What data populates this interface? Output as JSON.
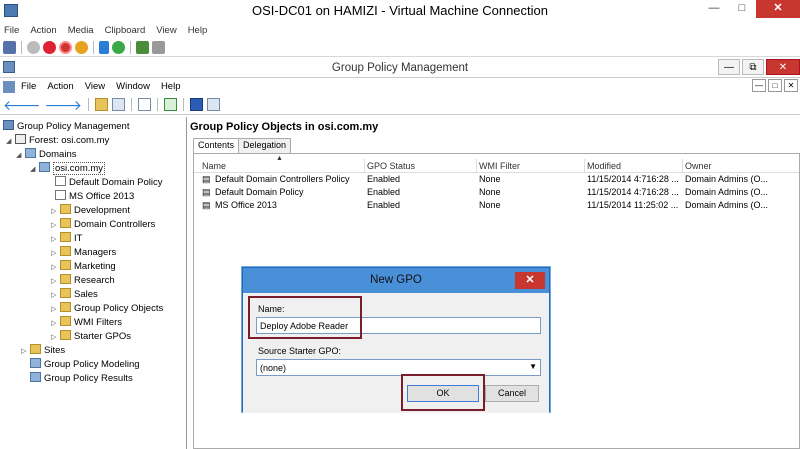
{
  "vm_window": {
    "title": "OSI-DC01 on HAMIZI - Virtual Machine Connection",
    "menu": [
      "File",
      "Action",
      "Media",
      "Clipboard",
      "View",
      "Help"
    ],
    "buttons": {
      "minimize": "—",
      "maximize": "□",
      "close": "✕"
    }
  },
  "gpm_window": {
    "title": "Group Policy Management",
    "menu": [
      "File",
      "Action",
      "View",
      "Window",
      "Help"
    ],
    "buttons": {
      "minimize": "—",
      "maximize": "⧉",
      "close": "✕",
      "mdi_min": "—",
      "mdi_max": "□",
      "mdi_close": "✕"
    }
  },
  "tree": {
    "root": "Group Policy Management",
    "forest": "Forest: osi.com.my",
    "domains": "Domains",
    "domain": "osi.com.my",
    "children": [
      "Default Domain Policy",
      "MS Office 2013",
      "Development",
      "Domain Controllers",
      "IT",
      "Managers",
      "Marketing",
      "Research",
      "Sales",
      "Group Policy Objects",
      "WMI Filters",
      "Starter GPOs"
    ],
    "sites": "Sites",
    "modeling": "Group Policy Modeling",
    "results": "Group Policy Results"
  },
  "right_pane": {
    "title": "Group Policy Objects in osi.com.my",
    "tabs": [
      "Contents",
      "Delegation"
    ],
    "columns": [
      "Name",
      "GPO Status",
      "WMI Filter",
      "Modified",
      "Owner"
    ],
    "rows": [
      [
        "Default Domain Controllers Policy",
        "Enabled",
        "None",
        "11/15/2014 4:716:28 ...",
        "Domain Admins (O..."
      ],
      [
        "Default Domain Policy",
        "Enabled",
        "None",
        "11/15/2014 4:716:28 ...",
        "Domain Admins (O..."
      ],
      [
        "MS Office 2013",
        "Enabled",
        "None",
        "11/15/2014 11:25:02 ...",
        "Domain Admins (O..."
      ]
    ]
  },
  "dialog": {
    "title": "New GPO",
    "close": "✕",
    "name_label": "Name:",
    "name_value": "Deploy Adobe Reader",
    "source_label": "Source Starter GPO:",
    "source_value": "(none)",
    "ok": "OK",
    "cancel": "Cancel"
  }
}
